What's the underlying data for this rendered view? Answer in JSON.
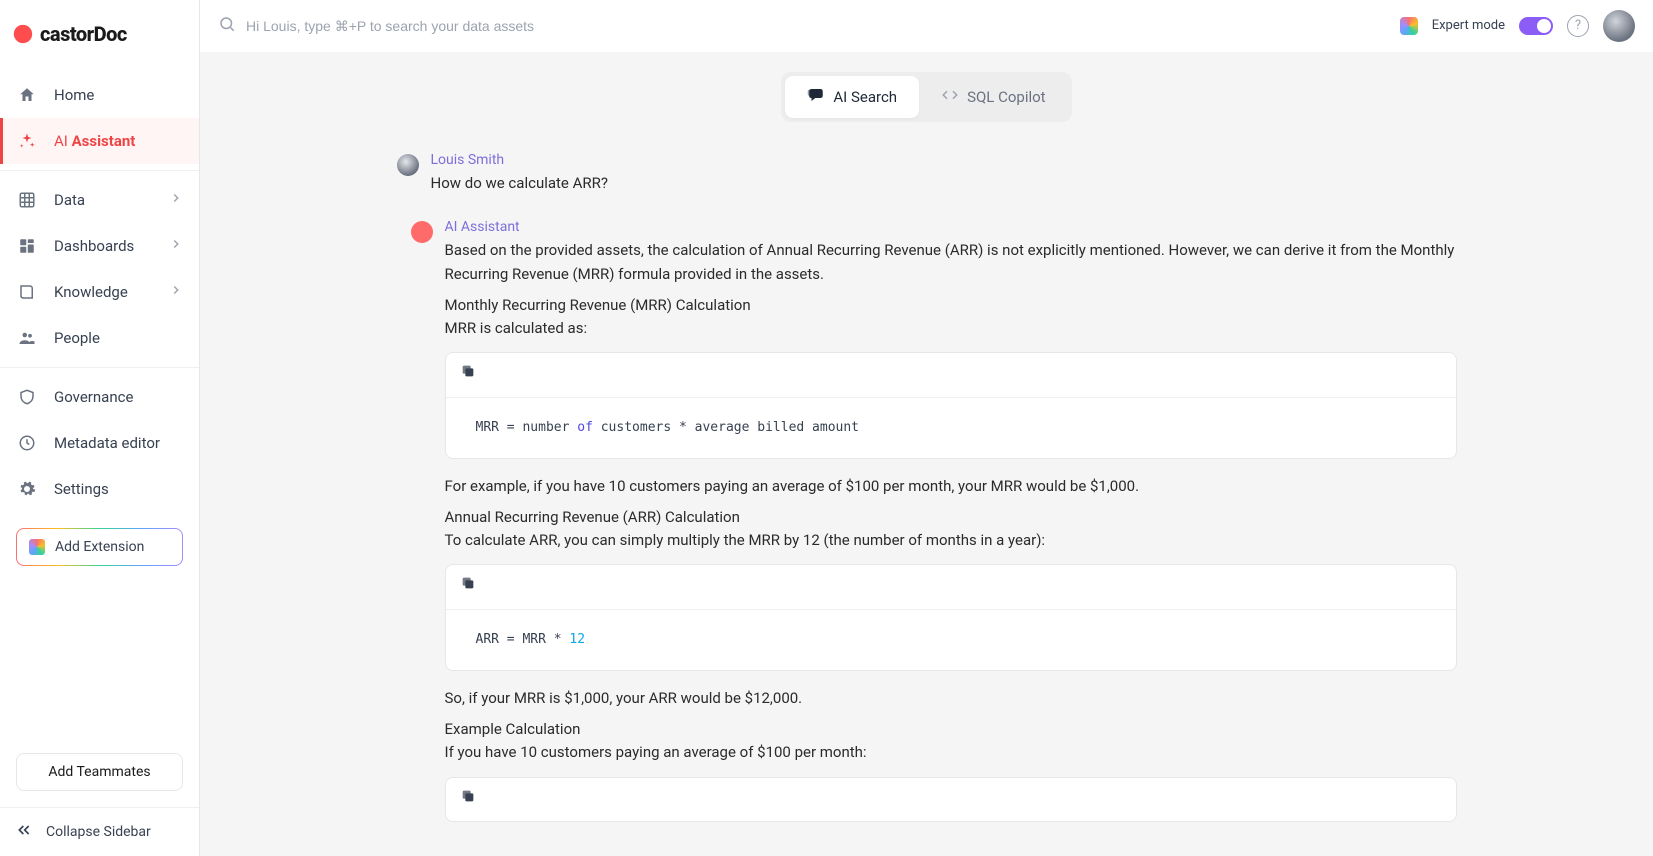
{
  "brand": "castorDoc",
  "sidebar": {
    "home": "Home",
    "ai_pre": "AI ",
    "ai_bold": "Assistant",
    "data": "Data",
    "dashboards": "Dashboards",
    "knowledge": "Knowledge",
    "people": "People",
    "governance": "Governance",
    "metadata": "Metadata editor",
    "settings": "Settings",
    "add_ext": "Add Extension",
    "add_team": "Add Teammates",
    "collapse": "Collapse Sidebar"
  },
  "topbar": {
    "search_placeholder": "Hi Louis, type ⌘+P to search your data assets",
    "expert": "Expert mode"
  },
  "tabs": {
    "ai_search": "AI Search",
    "sql_copilot": "SQL Copilot"
  },
  "chat": {
    "user_name": "Louis Smith",
    "user_msg": "How do we calculate ARR?",
    "bot_name": "AI Assistant",
    "bot_p1": "Based on the provided assets, the calculation of Annual Recurring Revenue (ARR) is not explicitly mentioned. However, we can derive it from the Monthly Recurring Revenue (MRR) formula provided in the assets.",
    "bot_h1a": "Monthly Recurring Revenue (MRR) Calculation",
    "bot_h1b": "MRR is calculated as:",
    "code1_pre": "MRR = number ",
    "code1_kw": "of",
    "code1_post": " customers * average billed amount",
    "bot_p2": "For example, if you have 10 customers paying an average of $100 per month, your MRR would be $1,000.",
    "bot_h2a": "Annual Recurring Revenue (ARR) Calculation",
    "bot_h2b": "To calculate ARR, you can simply multiply the MRR by 12 (the number of months in a year):",
    "code2_pre": "ARR = MRR * ",
    "code2_num": "12",
    "bot_p3": "So, if your MRR is $1,000, your ARR would be $12,000.",
    "bot_h3a": "Example Calculation",
    "bot_h3b": "If you have 10 customers paying an average of $100 per month:"
  }
}
